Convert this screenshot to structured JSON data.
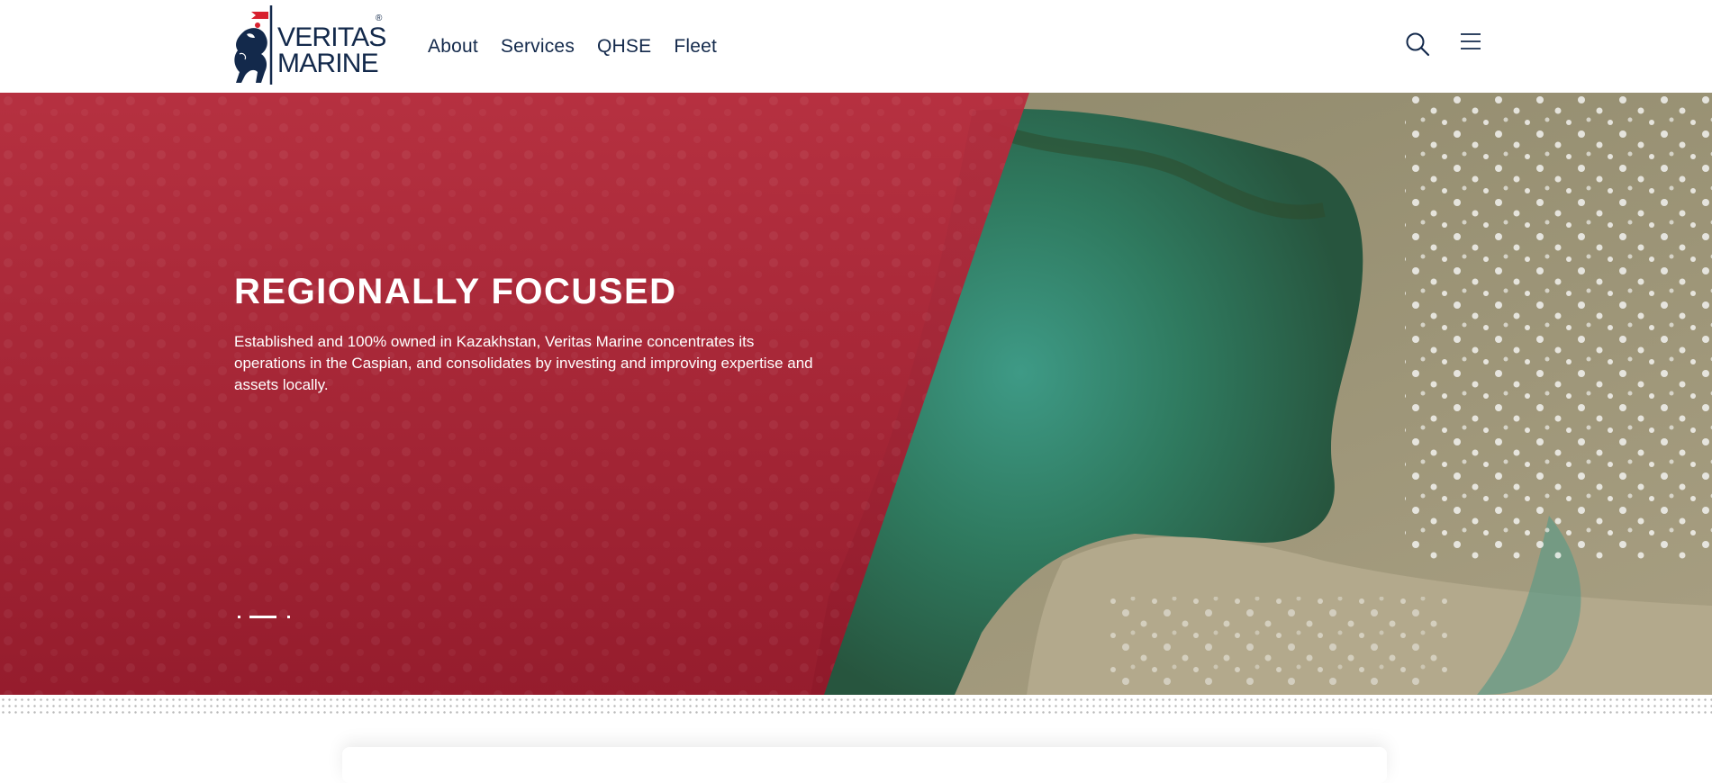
{
  "brand": {
    "line1": "VERITAS",
    "line2": "MARINE",
    "mark": "®",
    "colors": {
      "navy": "#13294b",
      "red": "#d8202e"
    }
  },
  "nav": {
    "items": [
      {
        "label": "About"
      },
      {
        "label": "Services"
      },
      {
        "label": "QHSE"
      },
      {
        "label": "Fleet"
      }
    ]
  },
  "header_icons": {
    "search": "search-icon",
    "menu": "hamburger-menu-icon"
  },
  "hero": {
    "title": "REGIONALLY FOCUSED",
    "text": "Established and 100% owned in Kazakhstan, Veritas Marine concentrates its operations in the Caspian, and consolidates by investing and improving expertise and assets locally.",
    "overlay_color": "#a3192d",
    "slides": {
      "count": 3,
      "active": 2
    }
  }
}
